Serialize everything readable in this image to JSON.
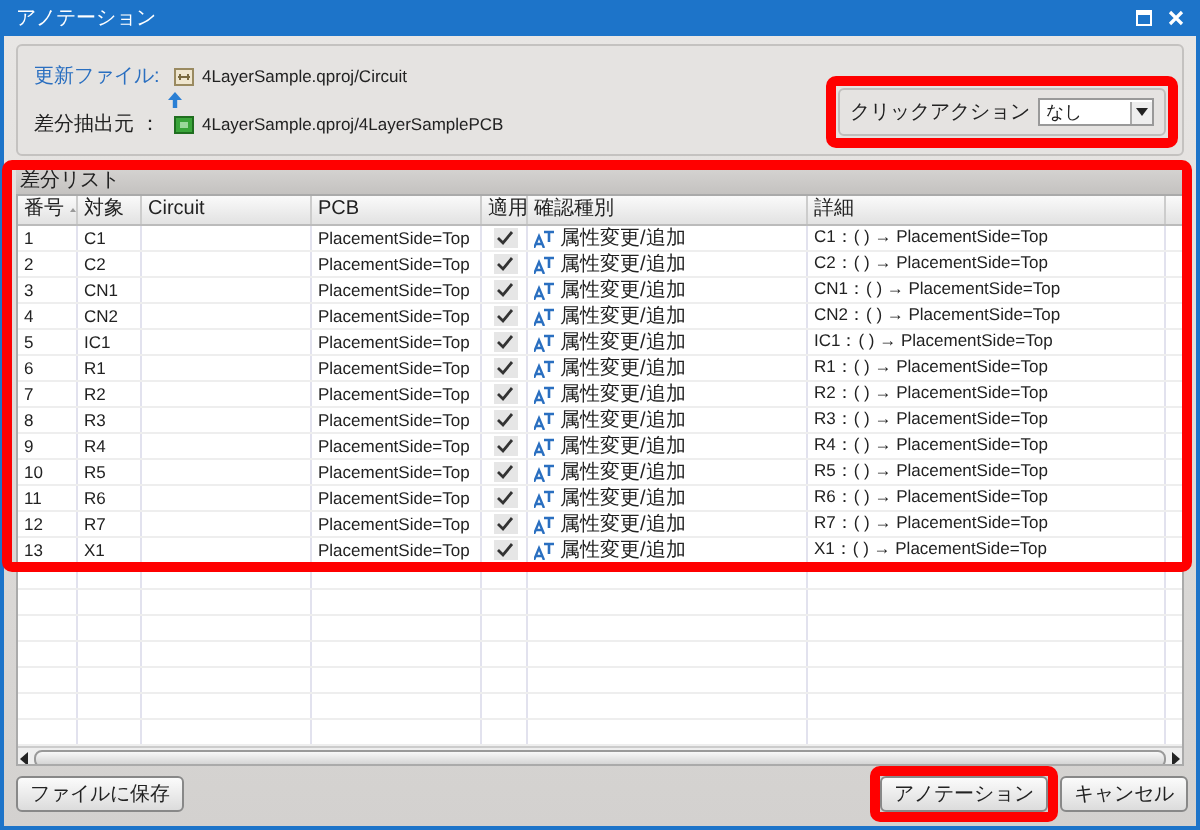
{
  "window": {
    "title": "アノテーション"
  },
  "files": [
    {
      "label": "更新ファイル:",
      "path": "4LayerSample.qproj/Circuit",
      "kind": "circuit"
    },
    {
      "label": "差分抽出元 ：",
      "path": "4LayerSample.qproj/4LayerSamplePCB",
      "kind": "pcb"
    }
  ],
  "click_action": {
    "label": "クリックアクション",
    "value": "なし"
  },
  "diff_list": {
    "title": "差分リスト",
    "columns": [
      "番号",
      "対象",
      "Circuit",
      "PCB",
      "適用",
      "確認種別",
      "詳細"
    ],
    "rows": [
      {
        "number": "1",
        "target": "C1",
        "pcb": "PlacementSide=Top",
        "checked": true,
        "kind": "属性変更/追加",
        "detail": "C1：( ) → PlacementSide=Top"
      },
      {
        "number": "2",
        "target": "C2",
        "pcb": "PlacementSide=Top",
        "checked": true,
        "kind": "属性変更/追加",
        "detail": "C2：( ) → PlacementSide=Top"
      },
      {
        "number": "3",
        "target": "CN1",
        "pcb": "PlacementSide=Top",
        "checked": true,
        "kind": "属性変更/追加",
        "detail": "CN1：( ) → PlacementSide=Top"
      },
      {
        "number": "4",
        "target": "CN2",
        "pcb": "PlacementSide=Top",
        "checked": true,
        "kind": "属性変更/追加",
        "detail": "CN2：( ) → PlacementSide=Top"
      },
      {
        "number": "5",
        "target": "IC1",
        "pcb": "PlacementSide=Top",
        "checked": true,
        "kind": "属性変更/追加",
        "detail": "IC1：( ) → PlacementSide=Top"
      },
      {
        "number": "6",
        "target": "R1",
        "pcb": "PlacementSide=Top",
        "checked": true,
        "kind": "属性変更/追加",
        "detail": "R1：( ) → PlacementSide=Top"
      },
      {
        "number": "7",
        "target": "R2",
        "pcb": "PlacementSide=Top",
        "checked": true,
        "kind": "属性変更/追加",
        "detail": "R2：( ) → PlacementSide=Top"
      },
      {
        "number": "8",
        "target": "R3",
        "pcb": "PlacementSide=Top",
        "checked": true,
        "kind": "属性変更/追加",
        "detail": "R3：( ) → PlacementSide=Top"
      },
      {
        "number": "9",
        "target": "R4",
        "pcb": "PlacementSide=Top",
        "checked": true,
        "kind": "属性変更/追加",
        "detail": "R4：( ) → PlacementSide=Top"
      },
      {
        "number": "10",
        "target": "R5",
        "pcb": "PlacementSide=Top",
        "checked": true,
        "kind": "属性変更/追加",
        "detail": "R5：( ) → PlacementSide=Top"
      },
      {
        "number": "11",
        "target": "R6",
        "pcb": "PlacementSide=Top",
        "checked": true,
        "kind": "属性変更/追加",
        "detail": "R6：( ) → PlacementSide=Top"
      },
      {
        "number": "12",
        "target": "R7",
        "pcb": "PlacementSide=Top",
        "checked": true,
        "kind": "属性変更/追加",
        "detail": "R7：( ) → PlacementSide=Top"
      },
      {
        "number": "13",
        "target": "X1",
        "pcb": "PlacementSide=Top",
        "checked": true,
        "kind": "属性変更/追加",
        "detail": "X1：( ) → PlacementSide=Top"
      }
    ]
  },
  "buttons": {
    "save": "ファイルに保存",
    "annotate": "アノテーション",
    "cancel": "キャンセル"
  }
}
